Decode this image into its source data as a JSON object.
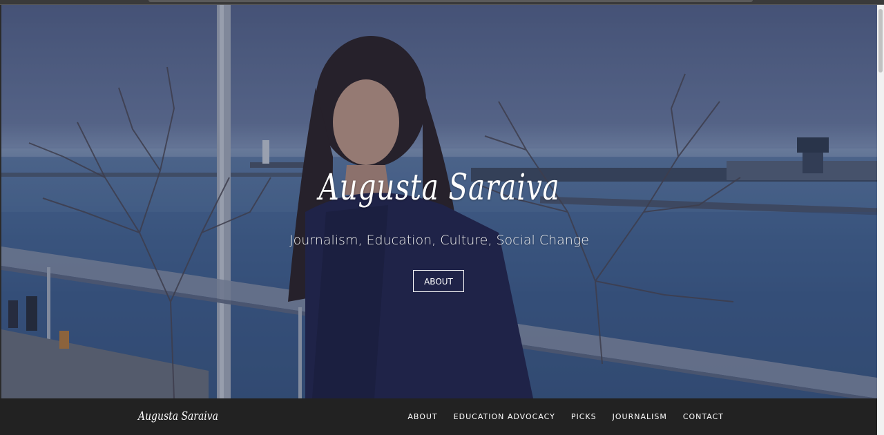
{
  "hero": {
    "title": "Augusta  Saraiva",
    "subtitle": "Journalism, Education, Culture, Social Change",
    "button_label": "ABOUT"
  },
  "navbar": {
    "brand": "Augusta  Saraiva",
    "links": [
      {
        "label": "ABOUT"
      },
      {
        "label": "EDUCATION ADVOCACY"
      },
      {
        "label": "PICKS"
      },
      {
        "label": "JOURNALISM"
      },
      {
        "label": "CONTACT"
      }
    ]
  },
  "colors": {
    "navbar_bg": "#222222",
    "text": "#ffffff"
  }
}
